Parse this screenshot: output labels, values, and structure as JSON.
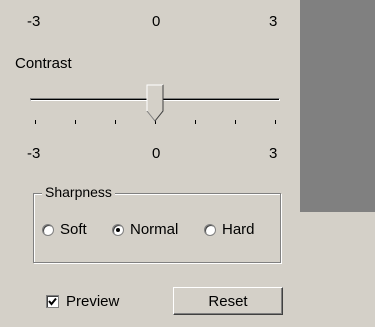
{
  "top_scale": {
    "min": "-3",
    "mid": "0",
    "max": "3"
  },
  "contrast": {
    "label": "Contrast",
    "scale": {
      "min": "-3",
      "mid": "0",
      "max": "3"
    },
    "value": 0,
    "min": -3,
    "max": 3
  },
  "sharpness": {
    "legend": "Sharpness",
    "options": [
      "Soft",
      "Normal",
      "Hard"
    ],
    "selected": "Normal"
  },
  "preview": {
    "label": "Preview",
    "checked": true
  },
  "reset_button": {
    "label": "Reset"
  },
  "colors": {
    "preview_area": "#808080",
    "dialog_bg": "#d4d0c8"
  }
}
